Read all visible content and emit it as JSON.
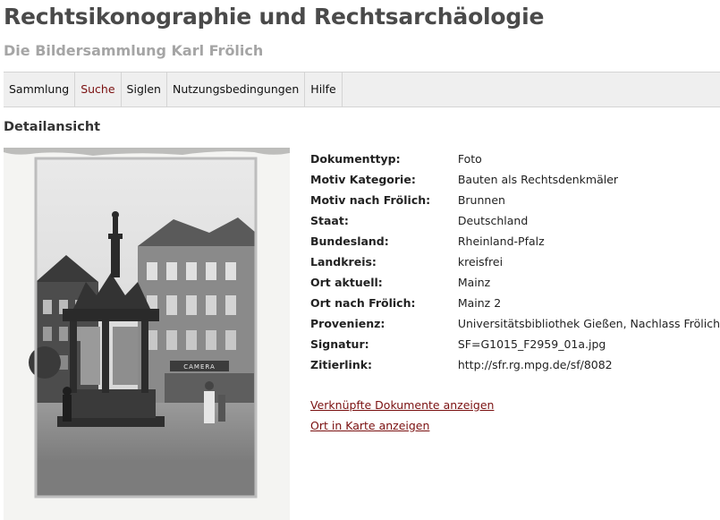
{
  "header": {
    "title": "Rechtsikonographie und Rechtsarchäologie",
    "subtitle": "Die Bildersammlung Karl Frölich"
  },
  "nav": [
    {
      "label": "Sammlung",
      "name": "nav-sammlung",
      "active": false
    },
    {
      "label": "Suche",
      "name": "nav-suche",
      "active": true
    },
    {
      "label": "Siglen",
      "name": "nav-siglen",
      "active": false
    },
    {
      "label": "Nutzungsbedingungen",
      "name": "nav-nutzungsbedingungen",
      "active": false
    },
    {
      "label": "Hilfe",
      "name": "nav-hilfe",
      "active": false
    }
  ],
  "main": {
    "heading": "Detailansicht",
    "image": {
      "sign_text": "CAMERA"
    },
    "fields": [
      {
        "key": "Dokumenttyp:",
        "value": "Foto"
      },
      {
        "key": "Motiv Kategorie:",
        "value": "Bauten als Rechtsdenkmäler"
      },
      {
        "key": "Motiv nach Frölich:",
        "value": "Brunnen"
      },
      {
        "key": "Staat:",
        "value": "Deutschland"
      },
      {
        "key": "Bundesland:",
        "value": "Rheinland-Pfalz"
      },
      {
        "key": "Landkreis:",
        "value": "kreisfrei"
      },
      {
        "key": "Ort aktuell:",
        "value": "Mainz"
      },
      {
        "key": "Ort nach Frölich:",
        "value": "Mainz 2"
      },
      {
        "key": "Provenienz:",
        "value": "Universitätsbibliothek Gießen, Nachlass Frölich"
      },
      {
        "key": "Signatur:",
        "value": "SF=G1015_F2959_01a.jpg"
      },
      {
        "key": "Zitierlink:",
        "value": "http://sfr.rg.mpg.de/sf/8082"
      }
    ],
    "links": {
      "linked_documents": "Verknüpfte Dokumente anzeigen",
      "map": "Ort in Karte anzeigen"
    }
  },
  "colors": {
    "accent": "#7a1010",
    "title": "#4a4a4a",
    "subtitle": "#a5a5a5",
    "nav_bg": "#efefef"
  }
}
